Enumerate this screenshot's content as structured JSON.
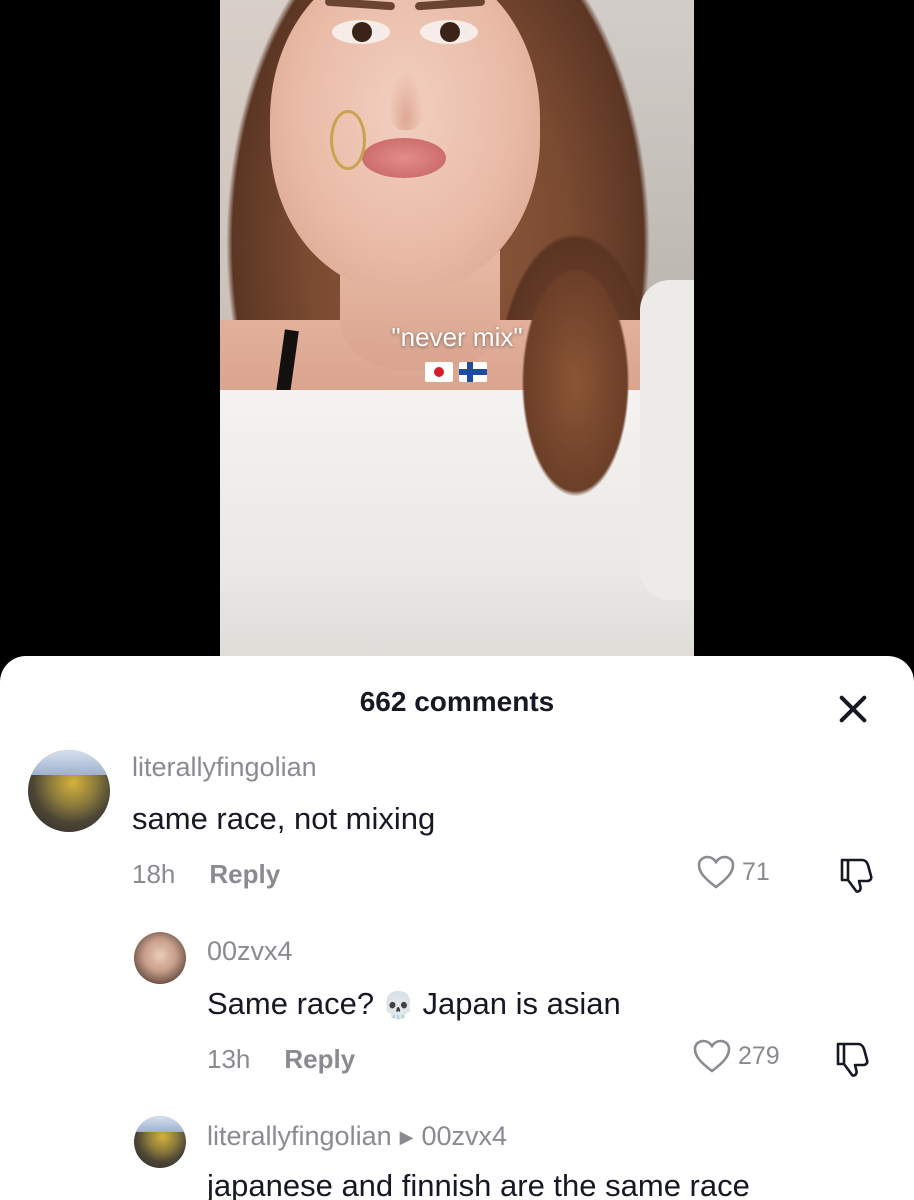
{
  "video": {
    "caption": "\"never mix\""
  },
  "comments_panel": {
    "count_label": "662 comments",
    "comments": [
      {
        "username": "literallyfingolian",
        "text": "same race, not mixing",
        "time": "18h",
        "reply_label": "Reply",
        "likes": "71"
      },
      {
        "username": "00zvx4",
        "text_before": "Same race?",
        "emoji": "💀",
        "text_after": "Japan is asian",
        "time": "13h",
        "reply_label": "Reply",
        "likes": "279"
      },
      {
        "username": "literallyfingolian",
        "reply_to": "00zvx4",
        "text": "japanese and finnish are the same race"
      }
    ]
  },
  "colors": {
    "text_primary": "#161823",
    "text_secondary": "#8a8b91",
    "sheet_bg": "#ffffff"
  }
}
